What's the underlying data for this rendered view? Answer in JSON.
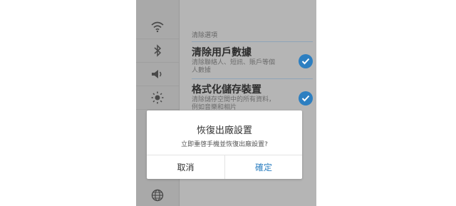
{
  "sidebar": {
    "icons": [
      "wifi-icon",
      "bluetooth-icon",
      "volume-icon",
      "brightness-icon",
      "globe-icon"
    ]
  },
  "settings": {
    "section_title": "清除選項",
    "options": [
      {
        "title": "清除用戶數據",
        "desc": "清除聯絡人、短訊、賬戶等個人數據",
        "checked": true
      },
      {
        "title": "格式化儲存裝置",
        "desc": "清除儲存空間中的所有資料，例如音樂和相片",
        "checked": true
      }
    ]
  },
  "dialog": {
    "title": "恢復出廠設置",
    "message": "立即重啓手機並恢復出廠設置?",
    "cancel_label": "取消",
    "confirm_label": "確定"
  },
  "colors": {
    "accent": "#2d7fc1",
    "overlay": "#b5b5b5"
  }
}
